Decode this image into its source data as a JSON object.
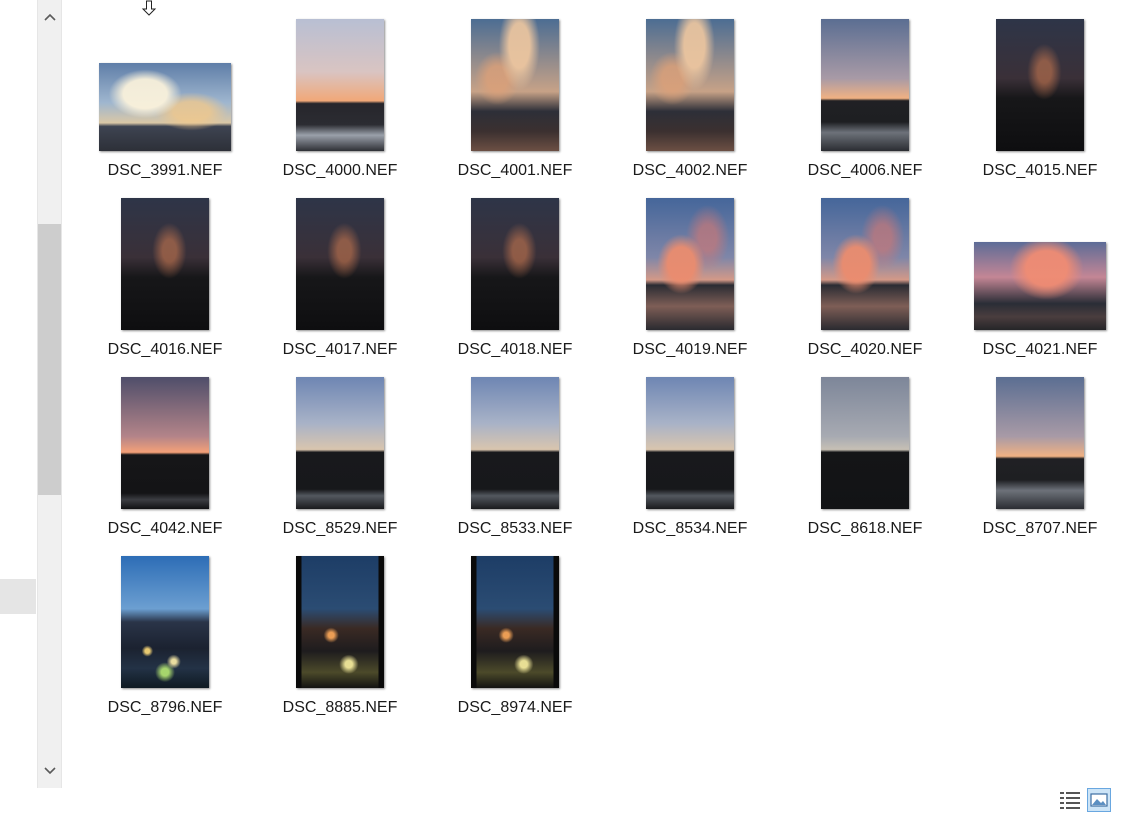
{
  "files": [
    {
      "name": "DSC_3991.NEF",
      "orientation": "landscape",
      "thumb": "cloudy-day"
    },
    {
      "name": "DSC_4000.NEF",
      "orientation": "portrait",
      "thumb": "dusk-sky"
    },
    {
      "name": "DSC_4001.NEF",
      "orientation": "portrait",
      "thumb": "cloud-portrait"
    },
    {
      "name": "DSC_4002.NEF",
      "orientation": "portrait",
      "thumb": "cloud-portrait"
    },
    {
      "name": "DSC_4006.NEF",
      "orientation": "portrait",
      "thumb": "blue-dusk"
    },
    {
      "name": "DSC_4015.NEF",
      "orientation": "portrait",
      "thumb": "night-dark"
    },
    {
      "name": "DSC_4016.NEF",
      "orientation": "portrait",
      "thumb": "night-dark"
    },
    {
      "name": "DSC_4017.NEF",
      "orientation": "portrait",
      "thumb": "night-dark"
    },
    {
      "name": "DSC_4018.NEF",
      "orientation": "portrait",
      "thumb": "night-dark"
    },
    {
      "name": "DSC_4019.NEF",
      "orientation": "portrait",
      "thumb": "pink-clouds"
    },
    {
      "name": "DSC_4020.NEF",
      "orientation": "portrait",
      "thumb": "pink-clouds"
    },
    {
      "name": "DSC_4021.NEF",
      "orientation": "landscape",
      "thumb": "pink-landscape"
    },
    {
      "name": "DSC_4042.NEF",
      "orientation": "portrait",
      "thumb": "orange-horizon"
    },
    {
      "name": "DSC_8529.NEF",
      "orientation": "portrait",
      "thumb": "blue-sky"
    },
    {
      "name": "DSC_8533.NEF",
      "orientation": "portrait",
      "thumb": "blue-sky"
    },
    {
      "name": "DSC_8534.NEF",
      "orientation": "portrait",
      "thumb": "blue-sky"
    },
    {
      "name": "DSC_8618.NEF",
      "orientation": "portrait",
      "thumb": "gray-sky"
    },
    {
      "name": "DSC_8707.NEF",
      "orientation": "portrait",
      "thumb": "blue-dusk"
    },
    {
      "name": "DSC_8796.NEF",
      "orientation": "portrait",
      "thumb": "night-lights"
    },
    {
      "name": "DSC_8885.NEF",
      "orientation": "portrait",
      "thumb": "night-frame"
    },
    {
      "name": "DSC_8974.NEF",
      "orientation": "portrait",
      "thumb": "night-frame"
    }
  ],
  "icons": {
    "scroll_up": "chevron-up-icon",
    "scroll_down": "chevron-down-icon",
    "cursor": "move-cursor-icon",
    "details_view": "details-view-icon",
    "thumbnail_view": "large-icons-view-icon"
  },
  "colors": {
    "selected_view_border": "#69a7e0",
    "selected_view_fill": "#cce4f7",
    "scrollbar_track": "#f0f0f0",
    "scrollbar_thumb": "#cdcdcd"
  }
}
